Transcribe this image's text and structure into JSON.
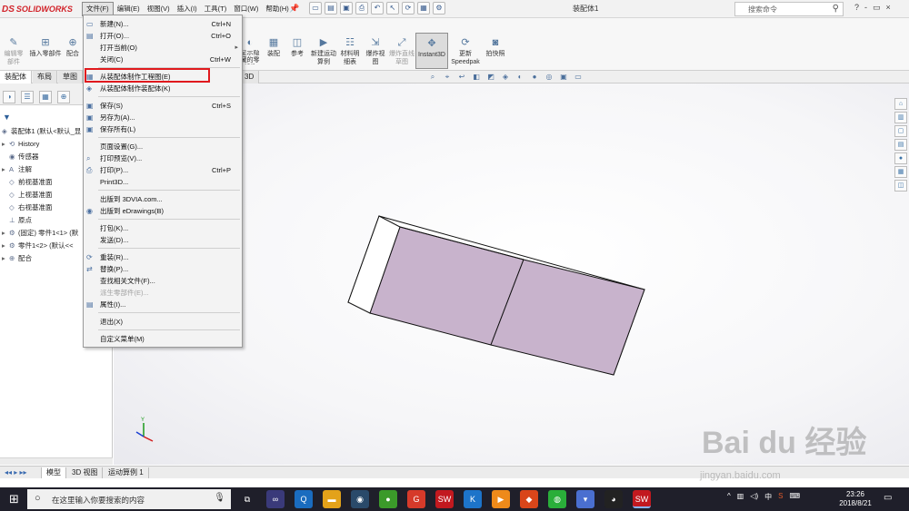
{
  "app": {
    "logo_text": "SOLIDWORKS",
    "logo_ds": "DS",
    "document_title": "装配体1"
  },
  "menubar": [
    {
      "label": "文件(F)",
      "active": true
    },
    {
      "label": "编辑(E)"
    },
    {
      "label": "视图(V)"
    },
    {
      "label": "插入(I)"
    },
    {
      "label": "工具(T)"
    },
    {
      "label": "窗口(W)"
    },
    {
      "label": "帮助(H)"
    }
  ],
  "search": {
    "placeholder": "搜索命令"
  },
  "help_controls": [
    "?",
    "-",
    "▭",
    "×"
  ],
  "command_manager": {
    "edit_component": "编辑零部件",
    "insert_component": "插入零部件",
    "mate": "配合",
    "show_hidden": "显示隐藏的零部件",
    "assembly": "装配",
    "reference": "参考",
    "new_motion_study": "新建运动算例",
    "bom": "材料明细表",
    "exploded_view": "爆炸视图",
    "exploded_line": "爆炸直线草图",
    "instant3d": "Instant3D",
    "update_speedpak": "更新Speedpak",
    "snapshot": "拍快照"
  },
  "tabs": [
    {
      "label": "装配体",
      "active": true
    },
    {
      "label": "布局"
    },
    {
      "label": "草图"
    }
  ],
  "tab_3d": "3D",
  "feature_tree": {
    "root": "装配体1 (默认<默认_显",
    "items": [
      {
        "label": "History",
        "expand": "▸",
        "icon": "⟲"
      },
      {
        "label": "传感器",
        "expand": "",
        "icon": "◉"
      },
      {
        "label": "注解",
        "expand": "▸",
        "icon": "A"
      },
      {
        "label": "前视基准面",
        "expand": "",
        "icon": "◇"
      },
      {
        "label": "上视基准面",
        "expand": "",
        "icon": "◇"
      },
      {
        "label": "右视基准面",
        "expand": "",
        "icon": "◇"
      },
      {
        "label": "原点",
        "expand": "",
        "icon": "⊥"
      },
      {
        "label": "(固定) 零件1<1> (默",
        "expand": "▸",
        "icon": "⚙"
      },
      {
        "label": "零件1<2> (默认<<",
        "expand": "▸",
        "icon": "⚙"
      },
      {
        "label": "配合",
        "expand": "▸",
        "icon": "⊕"
      }
    ]
  },
  "file_menu": {
    "new": {
      "label": "新建(N)...",
      "shortcut": "Ctrl+N"
    },
    "open": {
      "label": "打开(O)...",
      "shortcut": "Ctrl+O"
    },
    "open_current": {
      "label": "打开当前(O)"
    },
    "close": {
      "label": "关闭(C)",
      "shortcut": "Ctrl+W"
    },
    "make_drawing": {
      "label": "从装配体制作工程图(E)"
    },
    "make_assembly": {
      "label": "从装配体制作装配体(K)"
    },
    "save": {
      "label": "保存(S)",
      "shortcut": "Ctrl+S"
    },
    "save_as": {
      "label": "另存为(A)..."
    },
    "save_all": {
      "label": "保存所有(L)"
    },
    "page_setup": {
      "label": "页面设置(G)..."
    },
    "print_preview": {
      "label": "打印预览(V)..."
    },
    "print": {
      "label": "打印(P)...",
      "shortcut": "Ctrl+P"
    },
    "print3d": {
      "label": "Print3D..."
    },
    "publish_3dvia": {
      "label": "出版到 3DVIA.com..."
    },
    "publish_edrawings": {
      "label": "出版到 eDrawings(B)"
    },
    "pack_and_go": {
      "label": "打包(K)..."
    },
    "send": {
      "label": "发送(D)..."
    },
    "reload": {
      "label": "重装(R)..."
    },
    "replace": {
      "label": "替换(P)..."
    },
    "find_references": {
      "label": "查找相关文件(F)..."
    },
    "derive_component": {
      "label": "派生零部件(E)..."
    },
    "properties": {
      "label": "属性(I)..."
    },
    "exit": {
      "label": "退出(X)"
    },
    "customize": {
      "label": "自定义菜单(M)"
    }
  },
  "bottom_tabs": [
    {
      "label": "模型",
      "active": true
    },
    {
      "label": "3D 视图"
    },
    {
      "label": "运动算例 1"
    }
  ],
  "taskbar": {
    "search_placeholder": "在这里输入你要搜索的内容",
    "tray_input": "中",
    "tray_app": "S",
    "time": "23:26",
    "date": "2018/8/21"
  },
  "watermark": {
    "main": "Bai du 经验",
    "sub": "jingyan.baidu.com"
  },
  "colors": {
    "part_face": "#c8b3cc",
    "highlight": "#e0191d",
    "taskbar": "#1f1f2a"
  }
}
